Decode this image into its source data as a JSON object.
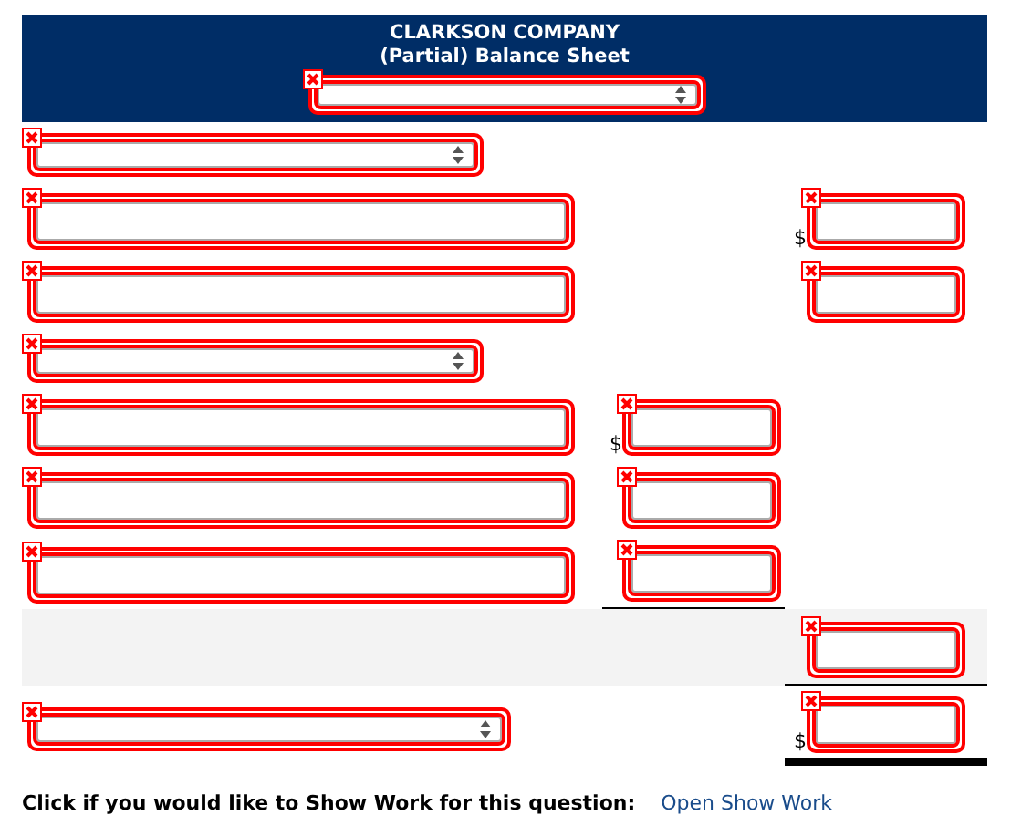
{
  "header": {
    "company": "CLARKSON COMPANY",
    "title": "(Partial) Balance Sheet",
    "select": {
      "incorrect": true
    }
  },
  "rows": [
    {
      "kind": "select",
      "shaded": false,
      "label": {
        "incorrect": true
      }
    },
    {
      "kind": "line",
      "shaded": false,
      "label": {
        "incorrect": true
      },
      "right": {
        "incorrect": true,
        "currency": "$"
      }
    },
    {
      "kind": "line",
      "shaded": false,
      "label": {
        "incorrect": true
      },
      "right": {
        "incorrect": true
      }
    },
    {
      "kind": "select",
      "shaded": false,
      "label": {
        "incorrect": true
      }
    },
    {
      "kind": "line",
      "shaded": false,
      "label": {
        "incorrect": true
      },
      "middle": {
        "incorrect": true,
        "currency": "$"
      }
    },
    {
      "kind": "line",
      "shaded": false,
      "label": {
        "incorrect": true
      },
      "middle": {
        "incorrect": true
      }
    },
    {
      "kind": "line",
      "shaded": false,
      "label": {
        "incorrect": true
      },
      "middle": {
        "incorrect": true,
        "underlined": true
      }
    },
    {
      "kind": "blank",
      "shaded": true,
      "right": {
        "incorrect": true,
        "underlined": true
      }
    },
    {
      "kind": "select-wide",
      "shaded": false,
      "label": {
        "incorrect": true
      },
      "right": {
        "incorrect": true,
        "currency": "$",
        "total": true
      }
    }
  ],
  "footer": {
    "prompt": "Click if you would like to Show Work for this question:",
    "link": "Open Show Work"
  }
}
